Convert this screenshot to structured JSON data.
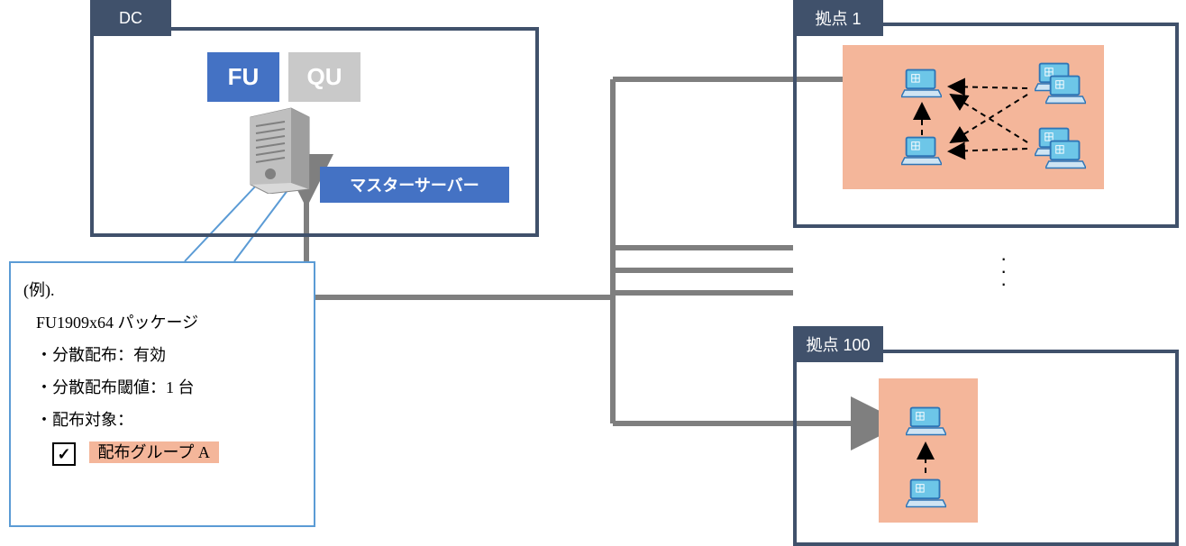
{
  "dc": {
    "label": "DC",
    "fu_tag": "FU",
    "qu_tag": "QU",
    "master_server_label": "マスターサーバー"
  },
  "callout": {
    "title": "(例).",
    "package": "FU1909x64 パッケージ",
    "item1": "・分散配布：有効",
    "item2": "・分散配布閾値：1 台",
    "item3": "・配布対象：",
    "checkbox_checked": "✓",
    "group_label": "配布グループ A"
  },
  "sites": {
    "site1_label": "拠点 1",
    "site100_label": "拠点 100"
  },
  "icons": {
    "server": "server-icon",
    "laptop": "laptop-icon",
    "ellipsis": "⋮"
  },
  "colors": {
    "frame": "#40516b",
    "accent_blue": "#4472c4",
    "callout_border": "#5b9bd5",
    "peach": "#f4b69a",
    "grey_tag": "#c9c9c9",
    "network_line": "#7f7f7f"
  }
}
